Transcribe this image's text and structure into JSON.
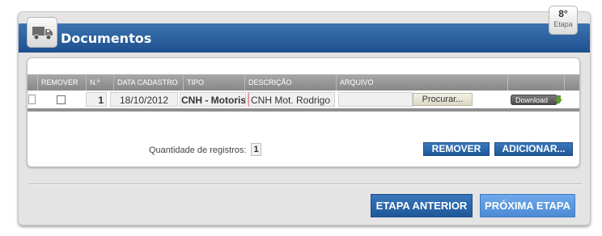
{
  "header": {
    "title": "Documentos"
  },
  "step": {
    "number": "8°",
    "label": "Etapa"
  },
  "table": {
    "columns": [
      "REMOVER",
      "N.º",
      "DATA CADASTRO",
      "TIPO",
      "DESCRIÇÃO",
      "ARQUIVO"
    ],
    "rows": [
      {
        "numero": "1",
        "data_cadastro": "18/10/2012",
        "tipo": "CNH - Motorista",
        "descricao": "CNH Mot. Rodrigo",
        "arquivo": "",
        "browse_label": "Procurar...",
        "download_label": "Download"
      }
    ]
  },
  "footer": {
    "count_label": "Quantidade de registros:",
    "count_value": "1",
    "remove_label": "REMOVER",
    "add_label": "ADICIONAR..."
  },
  "nav": {
    "prev_label": "ETAPA ANTERIOR",
    "next_label": "PRÓXIMA ETAPA"
  },
  "icons": {
    "header_icon": "truck-icon",
    "download_icon": "download-arrow-icon"
  },
  "colors": {
    "header_blue": "#1d4f8d",
    "button_blue": "#2664a8",
    "button_light_blue": "#5b97dd",
    "panel_gray": "#e4e4e4"
  }
}
